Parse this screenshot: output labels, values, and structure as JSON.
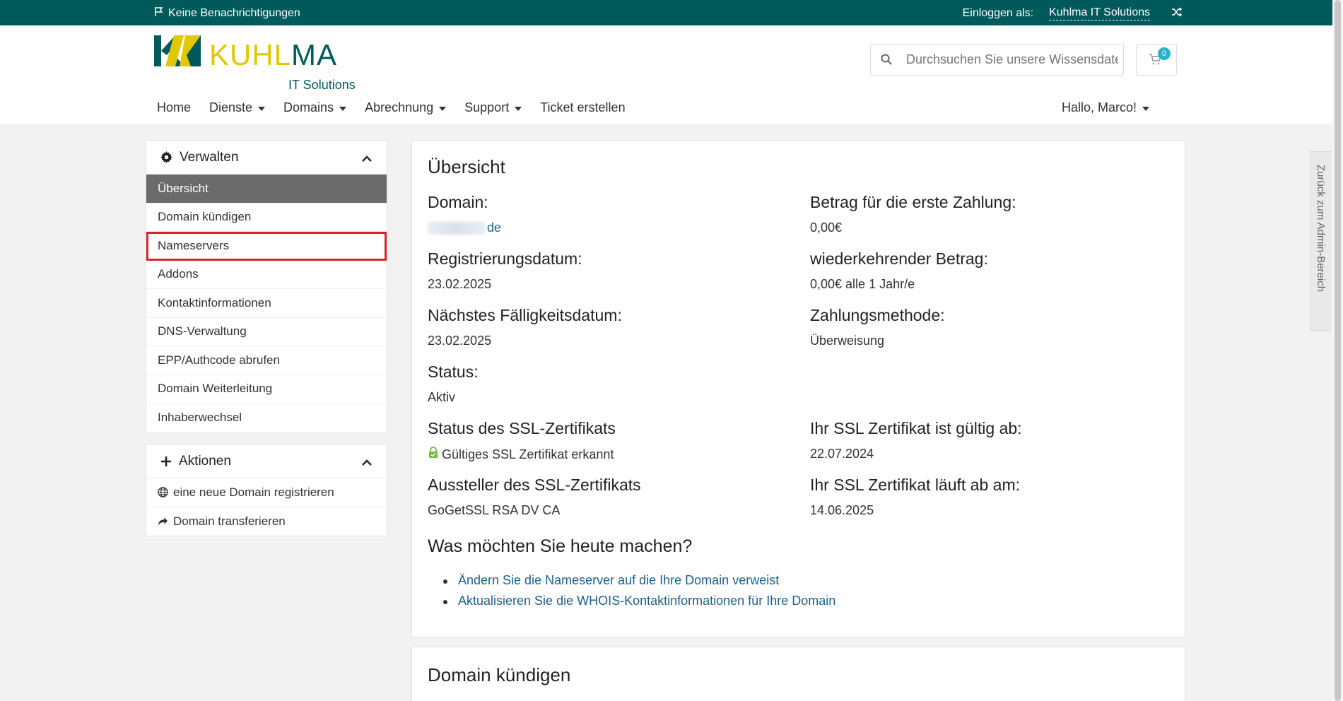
{
  "topbar": {
    "notifications": "Keine Benachrichtigungen",
    "login_label": "Einloggen als:",
    "login_account": "Kuhlma IT Solutions"
  },
  "logo": {
    "word_part1": "KUHL",
    "word_part2": "MA",
    "subtitle": "IT Solutions"
  },
  "search": {
    "placeholder": "Durchsuchen Sie unsere Wissensdatenbank..."
  },
  "cart": {
    "count": "0"
  },
  "nav": {
    "home": "Home",
    "services": "Dienste",
    "domains": "Domains",
    "billing": "Abrechnung",
    "support": "Support",
    "ticket": "Ticket erstellen",
    "user": "Hallo, Marco!"
  },
  "manage": {
    "title": "Verwalten",
    "items": [
      "Übersicht",
      "Domain kündigen",
      "Nameservers",
      "Addons",
      "Kontaktinformationen",
      "DNS-Verwaltung",
      "EPP/Authcode abrufen",
      "Domain Weiterleitung",
      "Inhaberwechsel"
    ]
  },
  "actions": {
    "title": "Aktionen",
    "register": "eine neue Domain registrieren",
    "transfer": "Domain transferieren"
  },
  "overview": {
    "title": "Übersicht",
    "domain_label": "Domain:",
    "domain_value": "de",
    "first_payment_label": "Betrag für die erste Zahlung:",
    "first_payment_value": "0,00€",
    "reg_date_label": "Registrierungsdatum:",
    "reg_date_value": "23.02.2025",
    "recurring_label": "wiederkehrender Betrag:",
    "recurring_value": "0,00€ alle 1 Jahr/e",
    "due_label": "Nächstes Fälligkeitsdatum:",
    "due_value": "23.02.2025",
    "pay_method_label": "Zahlungsmethode:",
    "pay_method_value": "Überweisung",
    "status_label": "Status:",
    "status_value": "Aktiv",
    "ssl_status_label": "Status des SSL-Zertifikats",
    "ssl_status_value": "Gültiges SSL Zertifikat erkannt",
    "ssl_valid_from_label": "Ihr SSL Zertifikat ist gültig ab:",
    "ssl_valid_from_value": "22.07.2024",
    "ssl_issuer_label": "Aussteller des SSL-Zertifikats",
    "ssl_issuer_value": "GoGetSSL RSA DV CA",
    "ssl_expires_label": "Ihr SSL Zertifikat läuft ab am:",
    "ssl_expires_value": "14.06.2025",
    "todo_title": "Was möchten Sie heute machen?",
    "todo_items": [
      "Ändern Sie die Nameserver auf die Ihre Domain verweist",
      "Aktualisieren Sie die WHOIS-Kontaktinformationen für Ihre Domain"
    ]
  },
  "cancel_section": {
    "title": "Domain kündigen"
  },
  "admin_tab": {
    "label": "Zurück zum Admin-Bereich"
  },
  "colors": {
    "brand": "#005a5b",
    "accent_yellow": "#e2c800",
    "link": "#1f5f8b",
    "highlight": "#d9232d"
  }
}
